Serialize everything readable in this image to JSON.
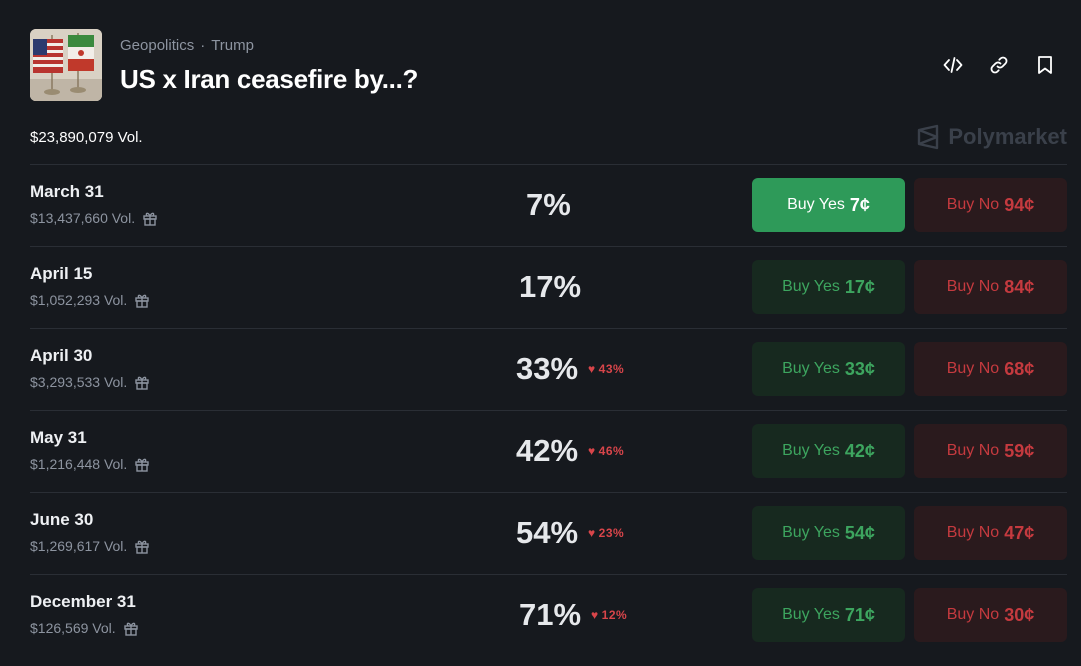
{
  "header": {
    "breadcrumb": [
      "Geopolitics",
      "Trump"
    ],
    "separator": "·",
    "title": "US x Iran ceasefire by...?",
    "actions": [
      "embed-icon",
      "link-icon",
      "bookmark-icon"
    ]
  },
  "total_volume": "$23,890,079 Vol.",
  "brand": "Polymarket",
  "colors": {
    "yes": "#2e9a59",
    "no": "#c53a3f",
    "change_down": "#d8454a"
  },
  "markets": [
    {
      "date": "March 31",
      "volume": "$13,437,660 Vol.",
      "chance": "7%",
      "change": "",
      "yes_label": "Buy Yes",
      "yes_price": "7¢",
      "no_label": "Buy No",
      "no_price": "94¢"
    },
    {
      "date": "April 15",
      "volume": "$1,052,293 Vol.",
      "chance": "17%",
      "change": "",
      "yes_label": "Buy Yes",
      "yes_price": "17¢",
      "no_label": "Buy No",
      "no_price": "84¢"
    },
    {
      "date": "April 30",
      "volume": "$3,293,533 Vol.",
      "chance": "33%",
      "change": "43%",
      "yes_label": "Buy Yes",
      "yes_price": "33¢",
      "no_label": "Buy No",
      "no_price": "68¢"
    },
    {
      "date": "May 31",
      "volume": "$1,216,448 Vol.",
      "chance": "42%",
      "change": "46%",
      "yes_label": "Buy Yes",
      "yes_price": "42¢",
      "no_label": "Buy No",
      "no_price": "59¢"
    },
    {
      "date": "June 30",
      "volume": "$1,269,617 Vol.",
      "chance": "54%",
      "change": "23%",
      "yes_label": "Buy Yes",
      "yes_price": "54¢",
      "no_label": "Buy No",
      "no_price": "47¢"
    },
    {
      "date": "December 31",
      "volume": "$126,569 Vol.",
      "chance": "71%",
      "change": "12%",
      "yes_label": "Buy Yes",
      "yes_price": "71¢",
      "no_label": "Buy No",
      "no_price": "30¢"
    }
  ]
}
